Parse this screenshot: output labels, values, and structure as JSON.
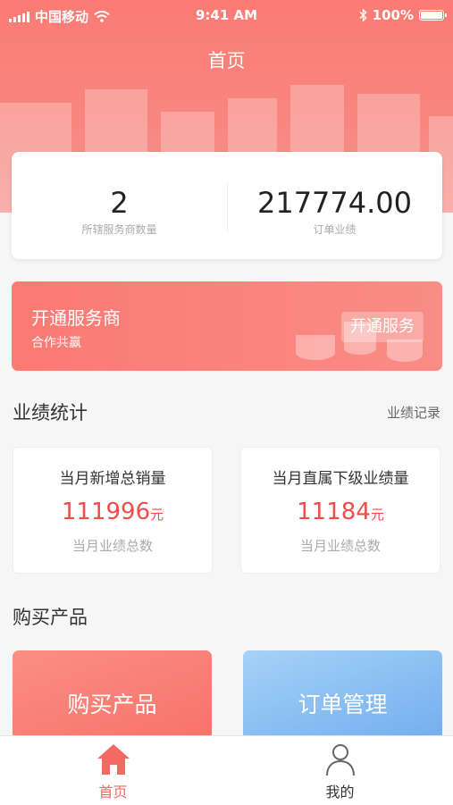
{
  "status_bar": {
    "carrier": "中国移动",
    "time": "9:41 AM",
    "battery": "100%"
  },
  "nav": {
    "title": "首页"
  },
  "stats": [
    {
      "value": "2",
      "label": "所辖服务商数量"
    },
    {
      "value": "217774.00",
      "label": "订单业绩"
    }
  ],
  "open_service": {
    "title": "开通服务商",
    "subtitle": "合作共赢",
    "button": "开通服务"
  },
  "performance": {
    "title": "业绩统计",
    "link": "业绩记录",
    "cards": [
      {
        "title": "当月新增总销量",
        "value": "111996",
        "unit": "元",
        "subtitle": "当月业绩总数"
      },
      {
        "title": "当月直属下级业绩量",
        "value": "11184",
        "unit": "元",
        "subtitle": "当月业绩总数"
      }
    ]
  },
  "buy_section": {
    "title": "购买产品",
    "tiles": [
      {
        "label": "购买产品"
      },
      {
        "label": "订单管理"
      }
    ]
  },
  "tabbar": {
    "items": [
      {
        "label": "首页",
        "icon": "home-icon",
        "active": true
      },
      {
        "label": "我的",
        "icon": "user-icon",
        "active": false
      }
    ]
  },
  "colors": {
    "primary": "#fb7b74",
    "accent_red": "#ee4d4d",
    "blue_tile": "#7fb8f2"
  }
}
